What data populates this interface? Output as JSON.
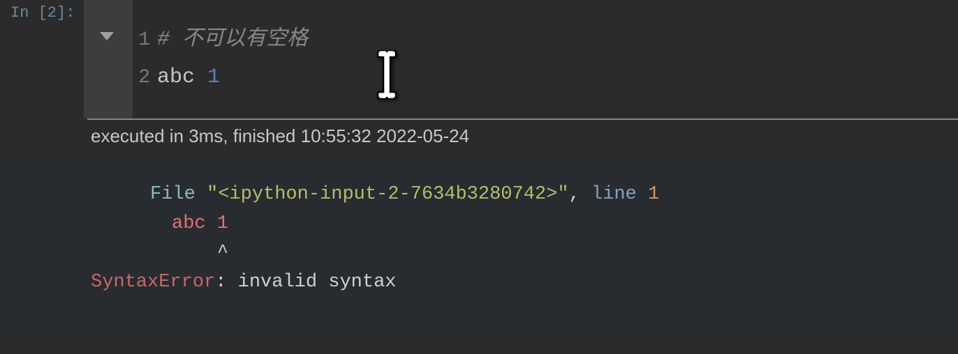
{
  "prompt": "In [2]:",
  "code": {
    "lines": [
      {
        "num": "1",
        "comment": "# 不可以有空格"
      },
      {
        "num": "2",
        "var": "abc",
        "val": "1"
      }
    ]
  },
  "exec_info": "executed in 3ms, finished 10:55:32 2022-05-24",
  "output": {
    "file_label": "File",
    "quote1": " \"",
    "filename": "<ipython-input-2-7634b3280742>",
    "quote2": "\"",
    "comma": ", ",
    "line_kw": "line ",
    "line_num": "1",
    "code_echo": "abc 1",
    "caret": "^",
    "error_type": "SyntaxError",
    "error_sep": ": ",
    "error_msg": "invalid syntax"
  }
}
